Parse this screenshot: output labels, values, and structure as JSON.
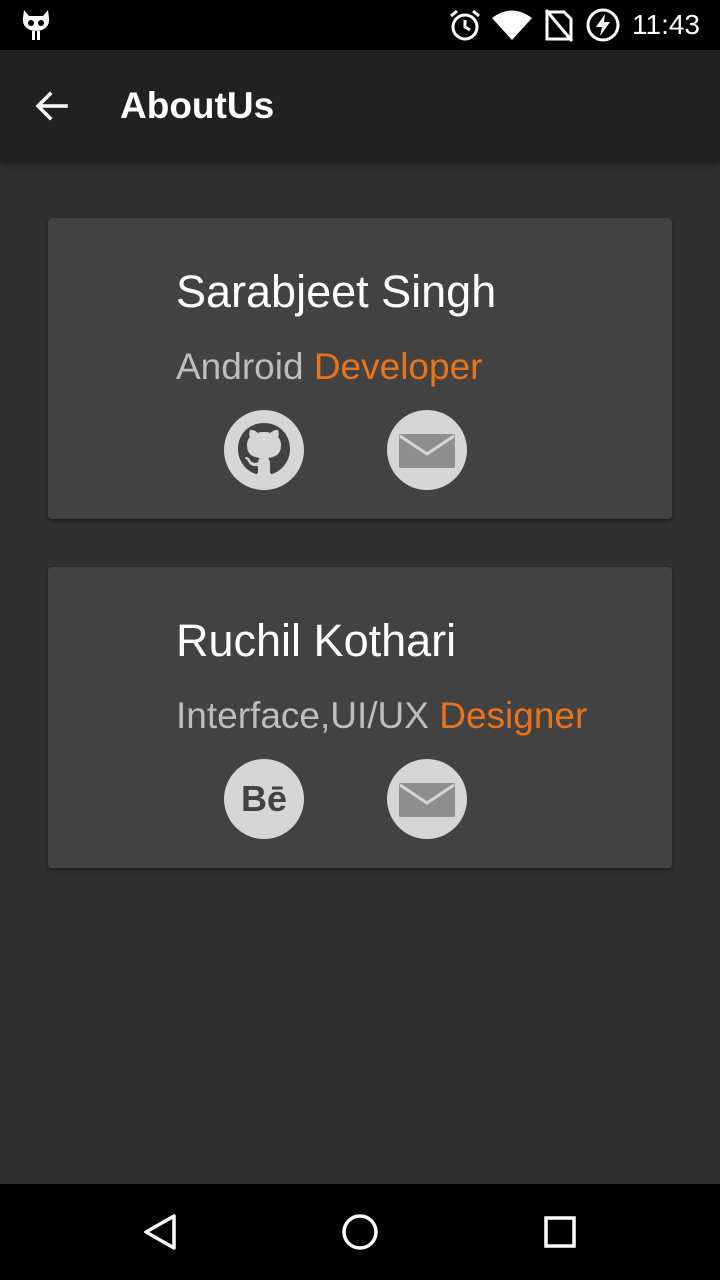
{
  "status_bar": {
    "time": "11:43",
    "icons": [
      "cyanogen-icon",
      "alarm-icon",
      "wifi-icon",
      "no-sim-signal-icon",
      "battery-charging-icon"
    ]
  },
  "app_bar": {
    "title": "AboutUs",
    "back_icon": "arrow-back-icon"
  },
  "colors": {
    "background": "#303030",
    "app_bar": "#212121",
    "card": "#424242",
    "accent": "#e8731a",
    "secondary_text": "#bdbdbd",
    "icon_circle": "#d6d6d6"
  },
  "members": [
    {
      "name": "Sarabjeet Singh",
      "role_prefix": "Android",
      "role_accent": "Developer",
      "links": [
        "github-icon",
        "email-icon"
      ]
    },
    {
      "name": "Ruchil Kothari",
      "role_prefix": "Interface,UI/UX",
      "role_accent": "Designer",
      "links": [
        "behance-icon",
        "email-icon"
      ]
    }
  ],
  "behance_label": "Bē",
  "nav_bar": {
    "buttons": [
      "nav-back-icon",
      "nav-home-icon",
      "nav-recents-icon"
    ]
  }
}
